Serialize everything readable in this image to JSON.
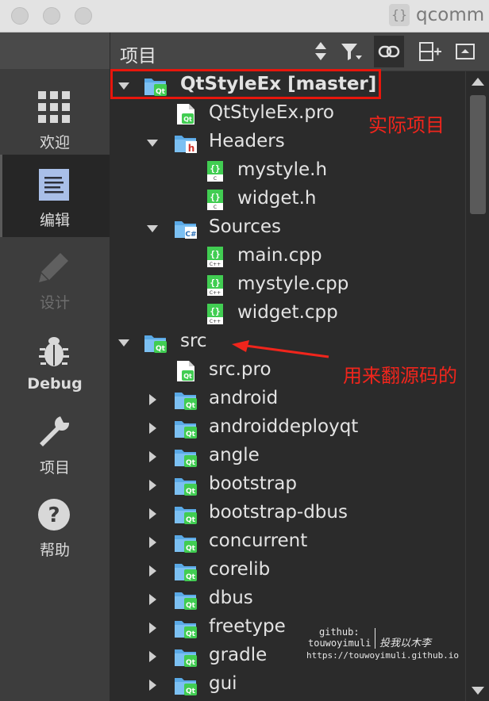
{
  "window": {
    "title": "qcomm"
  },
  "modes": [
    {
      "label": "欢迎",
      "icon": "grid-icon",
      "active": false,
      "enabled": true
    },
    {
      "label": "编辑",
      "icon": "document-icon",
      "active": true,
      "enabled": true
    },
    {
      "label": "设计",
      "icon": "pencil-icon",
      "active": false,
      "enabled": false
    },
    {
      "label": "Debug",
      "icon": "bug-icon",
      "active": false,
      "enabled": true
    },
    {
      "label": "项目",
      "icon": "wrench-icon",
      "active": false,
      "enabled": true
    },
    {
      "label": "帮助",
      "icon": "help-icon",
      "active": false,
      "enabled": true
    }
  ],
  "toolbar": {
    "title": "项目"
  },
  "tree": [
    {
      "label": "QtStyleEx [master]",
      "level": 0,
      "arrow": "down",
      "icon": "qt-folder-icon",
      "bold": true
    },
    {
      "label": "QtStyleEx.pro",
      "level": 1,
      "arrow": "none",
      "icon": "qt-pro-file-icon"
    },
    {
      "label": "Headers",
      "level": 1,
      "arrow": "down",
      "icon": "header-folder-icon"
    },
    {
      "label": "mystyle.h",
      "level": 2,
      "arrow": "none",
      "icon": "c-header-file-icon"
    },
    {
      "label": "widget.h",
      "level": 2,
      "arrow": "none",
      "icon": "c-header-file-icon"
    },
    {
      "label": "Sources",
      "level": 1,
      "arrow": "down",
      "icon": "source-folder-icon"
    },
    {
      "label": "main.cpp",
      "level": 2,
      "arrow": "none",
      "icon": "cpp-file-icon"
    },
    {
      "label": "mystyle.cpp",
      "level": 2,
      "arrow": "none",
      "icon": "cpp-file-icon"
    },
    {
      "label": "widget.cpp",
      "level": 2,
      "arrow": "none",
      "icon": "cpp-file-icon"
    },
    {
      "label": "src",
      "level": 0,
      "arrow": "down",
      "icon": "qt-folder-icon"
    },
    {
      "label": "src.pro",
      "level": 1,
      "arrow": "none",
      "icon": "qt-pro-file-icon"
    },
    {
      "label": "android",
      "level": 1,
      "arrow": "right",
      "icon": "qt-folder-icon"
    },
    {
      "label": "androiddeployqt",
      "level": 1,
      "arrow": "right",
      "icon": "qt-folder-icon"
    },
    {
      "label": "angle",
      "level": 1,
      "arrow": "right",
      "icon": "qt-folder-icon"
    },
    {
      "label": "bootstrap",
      "level": 1,
      "arrow": "right",
      "icon": "qt-folder-icon"
    },
    {
      "label": "bootstrap-dbus",
      "level": 1,
      "arrow": "right",
      "icon": "qt-folder-icon"
    },
    {
      "label": "concurrent",
      "level": 1,
      "arrow": "right",
      "icon": "qt-folder-icon"
    },
    {
      "label": "corelib",
      "level": 1,
      "arrow": "right",
      "icon": "qt-folder-icon"
    },
    {
      "label": "dbus",
      "level": 1,
      "arrow": "right",
      "icon": "qt-folder-icon"
    },
    {
      "label": "freetype",
      "level": 1,
      "arrow": "right",
      "icon": "qt-folder-icon"
    },
    {
      "label": "gradle",
      "level": 1,
      "arrow": "right",
      "icon": "qt-folder-icon"
    },
    {
      "label": "gui",
      "level": 1,
      "arrow": "right",
      "icon": "qt-folder-icon"
    }
  ],
  "annotations": {
    "actual_project": "实际项目",
    "source_browse": "用来翻源码的",
    "color": "#f0251c"
  },
  "watermark": {
    "line1": "github:",
    "line2": "touwoyimuli",
    "cn": "投我以木李",
    "url": "https://touwoyimuli.github.io"
  },
  "colors": {
    "qt_green": "#41cd52",
    "folder_blue": "#5aa9e6",
    "header_red": "#d0342c"
  }
}
